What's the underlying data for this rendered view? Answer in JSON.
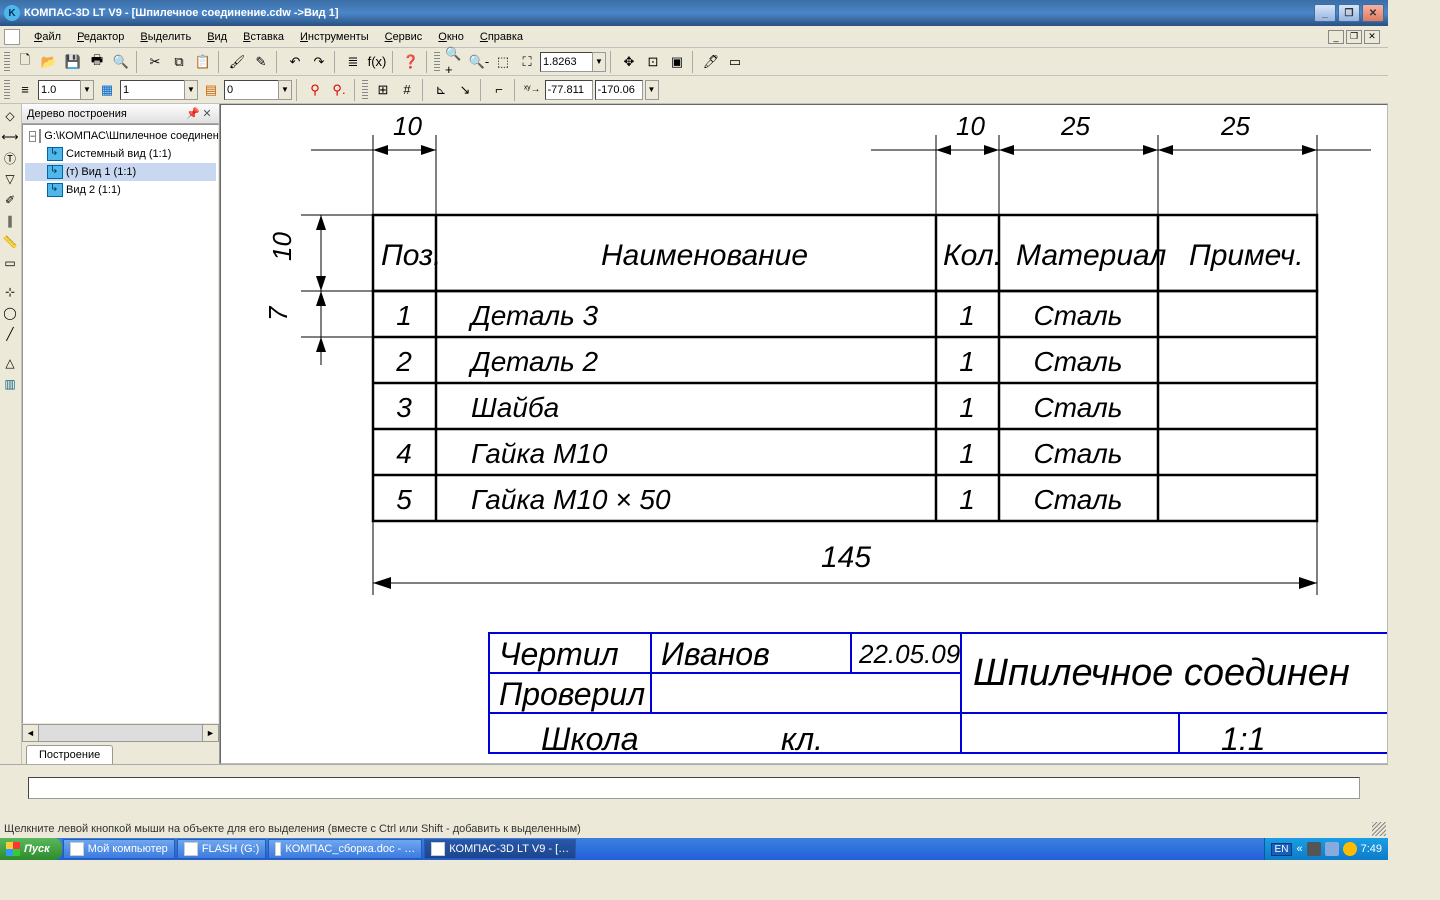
{
  "title": "КОМПАС-3D LT V9 - [Шпилечное соединение.cdw ->Вид 1]",
  "menus": [
    "Файл",
    "Редактор",
    "Выделить",
    "Вид",
    "Вставка",
    "Инструменты",
    "Сервис",
    "Окно",
    "Справка"
  ],
  "toolbar1": {
    "zoom": "1.8263"
  },
  "toolbar2": {
    "style": "1.0",
    "layer": "1",
    "lt": "0",
    "coord_x": "-77.811",
    "coord_y": "-170.06"
  },
  "tree": {
    "title": "Дерево построения",
    "root": "G:\\КОМПАС\\Шпилечное соединен",
    "items": [
      "Системный вид (1:1)",
      "(т) Вид 1 (1:1)",
      "Вид 2 (1:1)"
    ],
    "selected": 1,
    "tab": "Построение"
  },
  "drawing": {
    "dims": {
      "top_left": "10",
      "top_right1": "10",
      "top_right2": "25",
      "top_right3": "25",
      "left_top": "10",
      "left_bot": "7",
      "bottom": "145"
    },
    "headers": [
      "Поз.",
      "Наименование",
      "Кол.",
      "Материал",
      "Примеч."
    ],
    "rows": [
      {
        "pos": "1",
        "name": "Деталь 3",
        "qty": "1",
        "mat": "Сталь",
        "note": ""
      },
      {
        "pos": "2",
        "name": "Деталь 2",
        "qty": "1",
        "mat": "Сталь",
        "note": ""
      },
      {
        "pos": "3",
        "name": "Шайба",
        "qty": "1",
        "mat": "Сталь",
        "note": ""
      },
      {
        "pos": "4",
        "name": "Гайка М10",
        "qty": "1",
        "mat": "Сталь",
        "note": ""
      },
      {
        "pos": "5",
        "name": "Гайка М10 × 50",
        "qty": "1",
        "mat": "Сталь",
        "note": ""
      }
    ],
    "stamp": {
      "chertil": "Чертил",
      "proveril": "Проверил",
      "name": "Иванов",
      "date": "22.05.09",
      "title": "Шпилечное соединен",
      "shkola": "Школа",
      "kl": "кл.",
      "scale": "1:1"
    }
  },
  "status_hint": "Щелкните левой кнопкой мыши на объекте для его выделения (вместе с Ctrl или Shift - добавить к выделенным)",
  "taskbar": {
    "start": "Пуск",
    "buttons": [
      "Мой компьютер",
      "FLASH (G:)",
      "КОМПАС_сборка.doc - …",
      "КОМПАС-3D LT V9 - […"
    ],
    "active": 3,
    "lang": "EN",
    "time": "7:49",
    "chev": "«"
  }
}
